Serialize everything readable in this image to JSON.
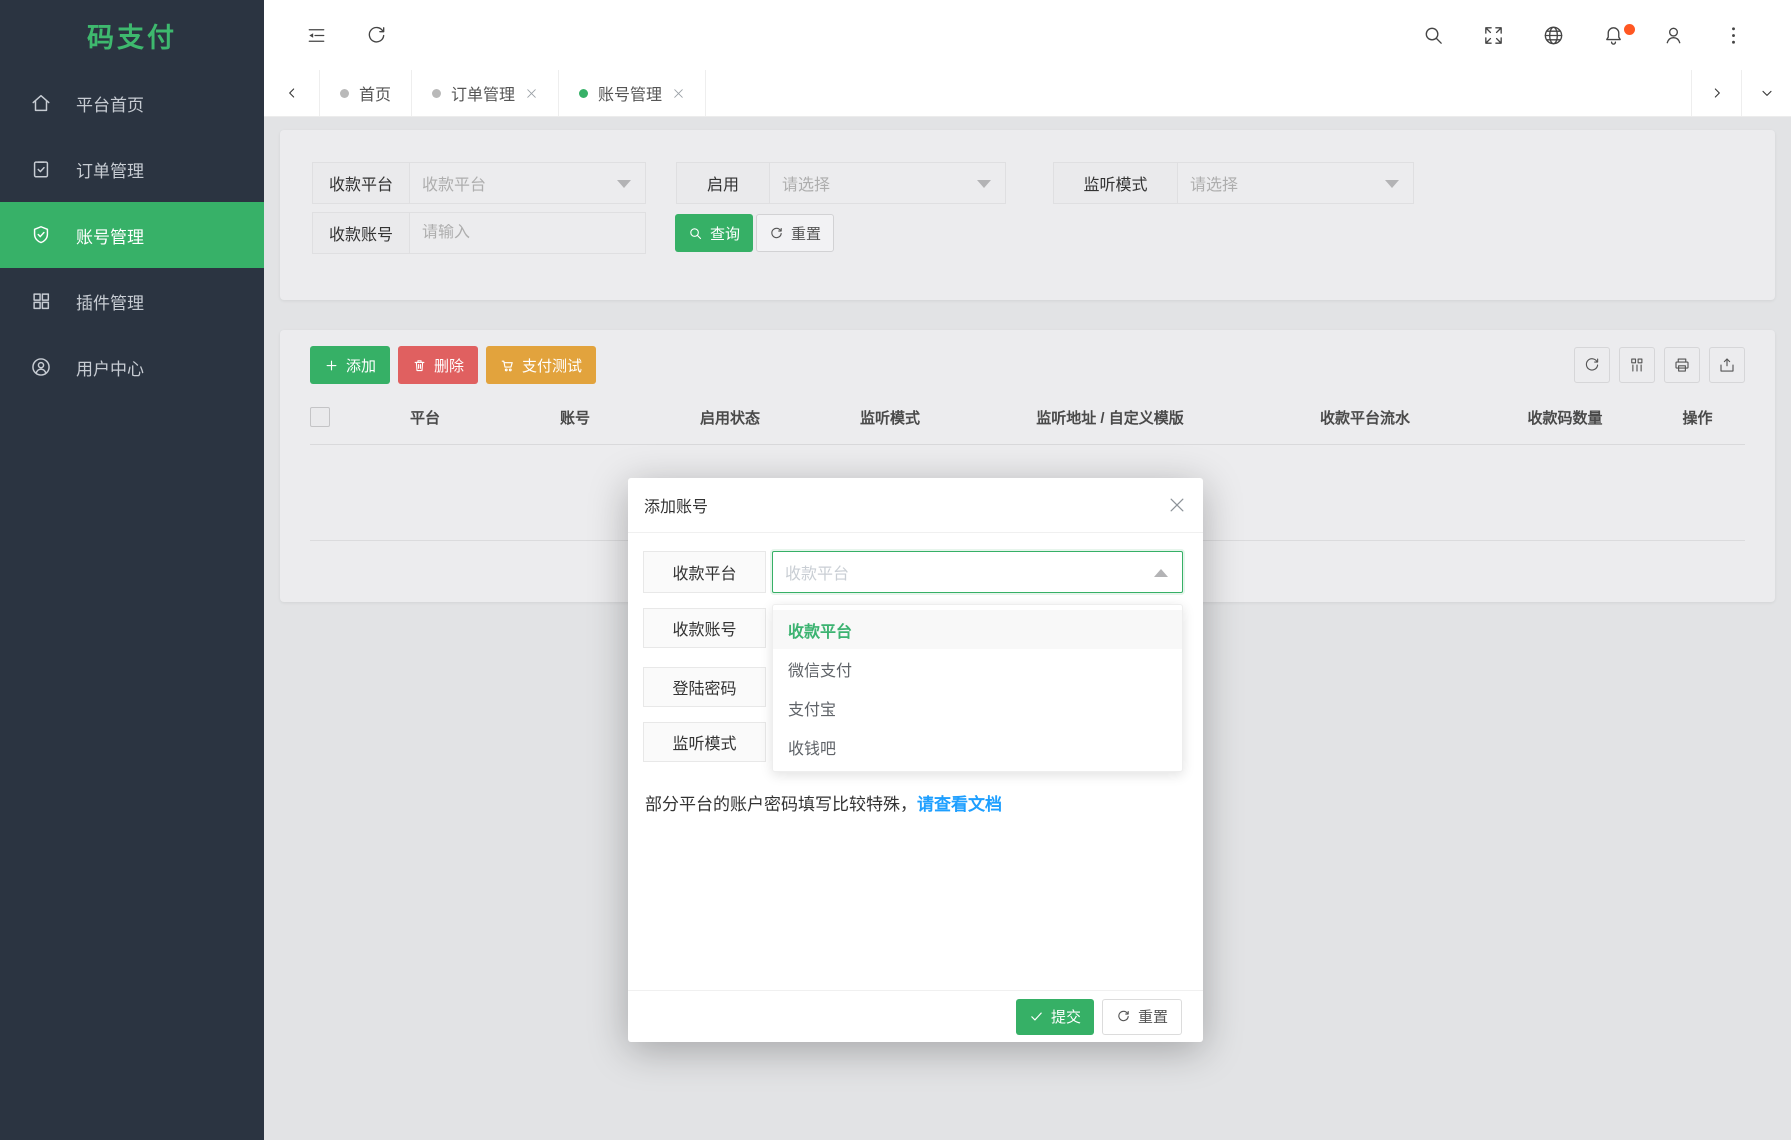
{
  "app": {
    "title": "码支付"
  },
  "sidebar": {
    "items": [
      {
        "label": "平台首页",
        "icon": "home-icon"
      },
      {
        "label": "订单管理",
        "icon": "order-icon"
      },
      {
        "label": "账号管理",
        "icon": "account-icon",
        "active": true
      },
      {
        "label": "插件管理",
        "icon": "plugin-icon"
      },
      {
        "label": "用户中心",
        "icon": "user-icon"
      }
    ]
  },
  "tabs": {
    "items": [
      {
        "label": "首页",
        "closable": false,
        "active": false
      },
      {
        "label": "订单管理",
        "closable": true,
        "active": false
      },
      {
        "label": "账号管理",
        "closable": true,
        "active": true
      }
    ]
  },
  "filters": {
    "platform_label": "收款平台",
    "platform_placeholder": "收款平台",
    "enable_label": "启用",
    "enable_placeholder": "请选择",
    "listen_label": "监听模式",
    "listen_placeholder": "请选择",
    "account_label": "收款账号",
    "account_placeholder": "请输入",
    "query_label": "查询",
    "reset_label": "重置"
  },
  "toolbar": {
    "add_label": "添加",
    "delete_label": "删除",
    "pay_test_label": "支付测试"
  },
  "table": {
    "columns": [
      "平台",
      "账号",
      "启用状态",
      "监听模式",
      "监听地址 / 自定义模版",
      "收款平台流水",
      "收款码数量",
      "操作"
    ]
  },
  "modal": {
    "title": "添加账号",
    "fields": [
      {
        "label": "收款平台",
        "placeholder": "收款平台"
      },
      {
        "label": "收款账号"
      },
      {
        "label": "登陆密码"
      },
      {
        "label": "监听模式"
      }
    ],
    "dropdown": {
      "options": [
        "收款平台",
        "微信支付",
        "支付宝",
        "收钱吧"
      ],
      "selected_index": 0
    },
    "tip_text": "部分平台的账户密码填写比较特殊，",
    "tip_link": "请查看文档",
    "submit_label": "提交",
    "reset_label": "重置"
  },
  "colors": {
    "green": "#36b066",
    "sidebar_green": "#37b168",
    "logo_green": "#3eb96e",
    "red": "#e06060",
    "orange": "#e2a33d",
    "link_blue": "#1e9fff",
    "notification_dot": "#ff5722",
    "sidebar_bg": "#2b3441"
  }
}
